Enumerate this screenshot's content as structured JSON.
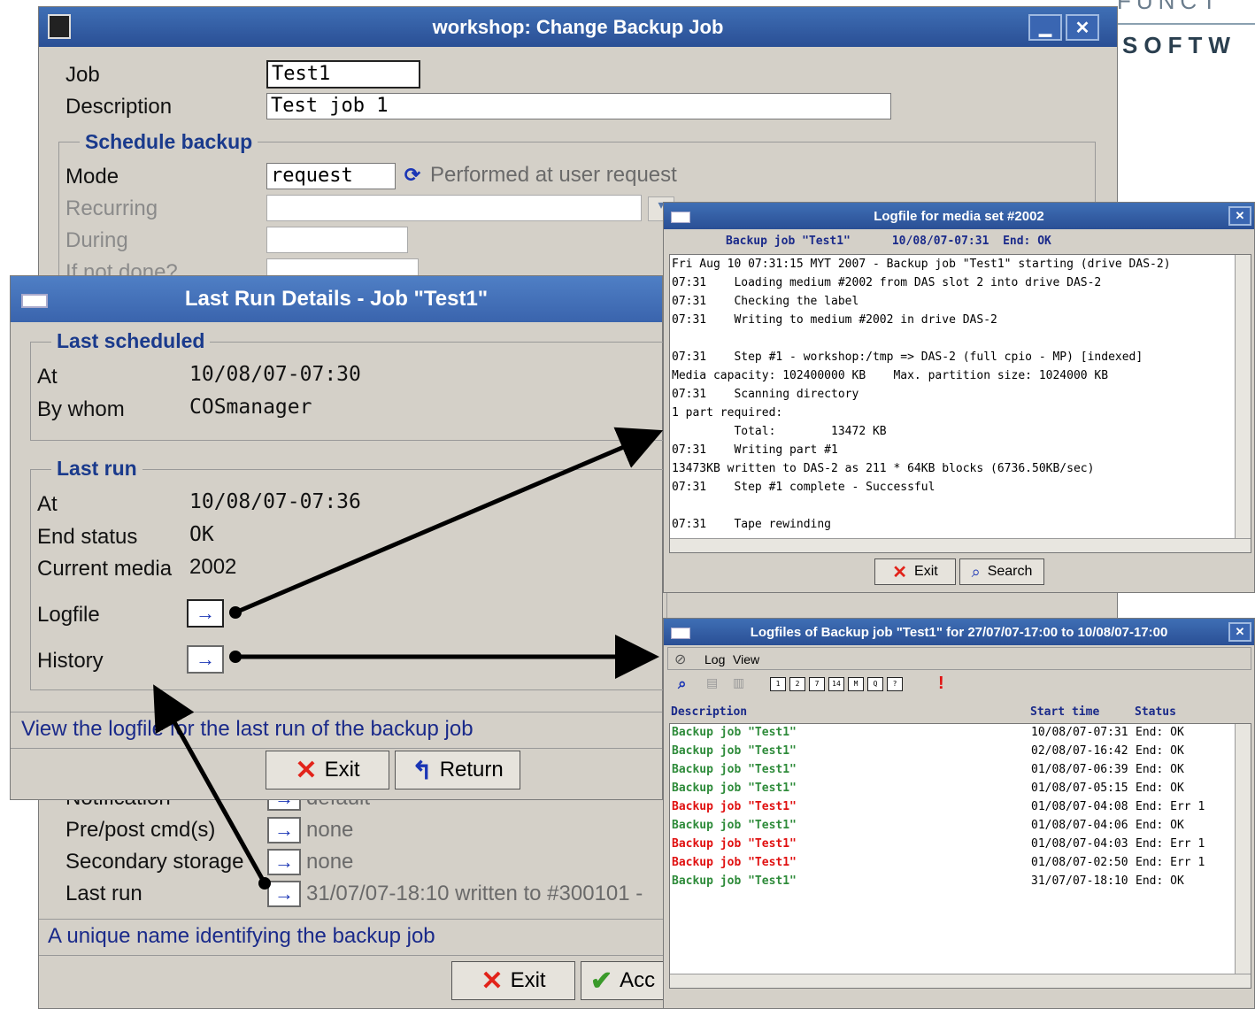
{
  "brand": {
    "line1": "FUNCT",
    "line2": "SOFTW"
  },
  "main_window": {
    "title": "workshop: Change Backup Job",
    "labels": {
      "job": "Job",
      "description": "Description",
      "mode": "Mode",
      "recurring": "Recurring",
      "during": "During",
      "if_not_done": "If not done?",
      "notification": "Notification",
      "prepost": "Pre/post cmd(s)",
      "secondary": "Secondary storage",
      "last_run": "Last run"
    },
    "job_value": "Test1",
    "description_value": "Test job 1",
    "schedule_group": "Schedule backup",
    "mode_value": "request",
    "mode_hint": "Performed at user request",
    "notification_value": "default",
    "prepost_value": "none",
    "secondary_value": "none",
    "last_run_value": "31/07/07-18:10 written to #300101 -",
    "status_text": "A unique name identifying the backup job",
    "exit_label": "Exit",
    "accept_label": "Acc"
  },
  "last_run_window": {
    "title": "Last Run Details - Job \"Test1\"",
    "scheduled_group": "Last scheduled",
    "at_label": "At",
    "at_value": "10/08/07-07:30",
    "bywhom_label": "By whom",
    "bywhom_value": "COSmanager",
    "lastrun_group": "Last run",
    "run_at_label": "At",
    "run_at_value": "10/08/07-07:36",
    "end_status_label": "End status",
    "end_status_value": "OK",
    "current_media_label": "Current media",
    "current_media_value": "2002",
    "logfile_label": "Logfile",
    "history_label": "History",
    "status_text": "View the logfile for the last run of the backup job",
    "exit_label": "Exit",
    "return_label": "Return"
  },
  "logfile_window": {
    "title": "Logfile for media set #2002",
    "header": "Backup job \"Test1\"      10/08/07-07:31  End: OK",
    "lines": [
      "Fri Aug 10 07:31:15 MYT 2007 - Backup job \"Test1\" starting (drive DAS-2)",
      "07:31    Loading medium #2002 from DAS slot 2 into drive DAS-2",
      "07:31    Checking the label",
      "07:31    Writing to medium #2002 in drive DAS-2",
      "",
      "07:31    Step #1 - workshop:/tmp => DAS-2 (full cpio - MP) [indexed]",
      "Media capacity: 102400000 KB    Max. partition size: 1024000 KB",
      "07:31    Scanning directory",
      "1 part required:",
      "         Total:        13472 KB",
      "07:31    Writing part #1",
      "13473KB written to DAS-2 as 211 * 64KB blocks (6736.50KB/sec)",
      "07:31    Step #1 complete - Successful",
      "",
      "07:31    Tape rewinding"
    ],
    "exit_label": "Exit",
    "search_label": "Search"
  },
  "history_window": {
    "title": "Logfiles of Backup job \"Test1\" for 27/07/07-17:00 to 10/08/07-17:00",
    "menu": [
      "Log",
      "View"
    ],
    "toolbar_icons": [
      "1",
      "2",
      "7",
      "14",
      "M",
      "Q",
      "?"
    ],
    "col_description": "Description",
    "col_start": "Start time",
    "col_status": "Status",
    "rows": [
      {
        "desc": "Backup job \"Test1\"",
        "start": "10/08/07-07:31",
        "status": "End: OK",
        "color": "#2e8b3a"
      },
      {
        "desc": "Backup job \"Test1\"",
        "start": "02/08/07-16:42",
        "status": "End: OK",
        "color": "#2e8b3a"
      },
      {
        "desc": "Backup job \"Test1\"",
        "start": "01/08/07-06:39",
        "status": "End: OK",
        "color": "#2e8b3a"
      },
      {
        "desc": "Backup job \"Test1\"",
        "start": "01/08/07-05:15",
        "status": "End: OK",
        "color": "#2e8b3a"
      },
      {
        "desc": "Backup job \"Test1\"",
        "start": "01/08/07-04:08",
        "status": "End: Err 1",
        "color": "#e01010"
      },
      {
        "desc": "Backup job \"Test1\"",
        "start": "01/08/07-04:06",
        "status": "End: OK",
        "color": "#2e8b3a"
      },
      {
        "desc": "Backup job \"Test1\"",
        "start": "01/08/07-04:03",
        "status": "End: Err 1",
        "color": "#e01010"
      },
      {
        "desc": "Backup job \"Test1\"",
        "start": "01/08/07-02:50",
        "status": "End: Err 1",
        "color": "#e01010"
      },
      {
        "desc": "Backup job \"Test1\"",
        "start": "31/07/07-18:10",
        "status": "End: OK",
        "color": "#2e8b3a"
      }
    ]
  }
}
